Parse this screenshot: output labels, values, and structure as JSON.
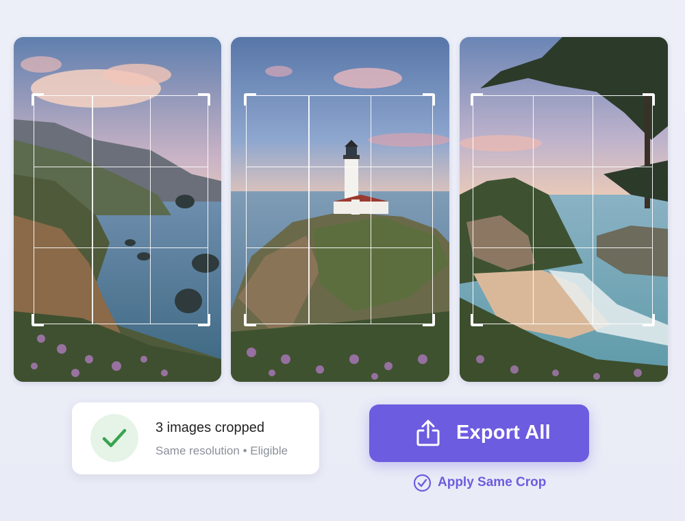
{
  "images": [
    {
      "name": "coastal-cliffs"
    },
    {
      "name": "lighthouse-cliff"
    },
    {
      "name": "cove-beach-tree"
    }
  ],
  "status": {
    "title": "3 images cropped",
    "subtitle": "Same resolution • Eligible",
    "icon": "check-icon",
    "icon_color": "#3aa34f"
  },
  "export_button": {
    "label": "Export All",
    "icon": "share-upload-icon",
    "color": "#6c5ce0"
  },
  "apply_same_crop": {
    "label": "Apply Same Crop",
    "icon": "check-circle-icon"
  }
}
